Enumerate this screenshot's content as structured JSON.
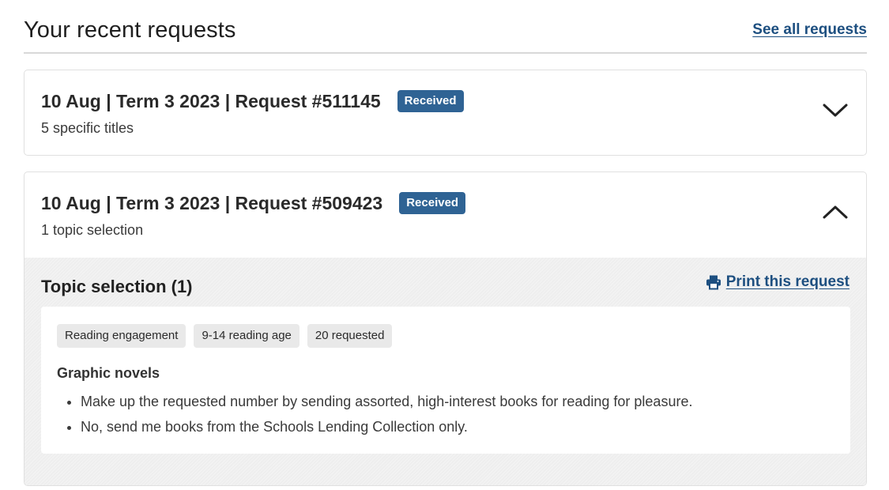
{
  "header": {
    "title": "Your recent requests",
    "see_all_label": "See all requests"
  },
  "requests": [
    {
      "title": "10 Aug | Term 3 2023 | Request #511145",
      "status": "Received",
      "summary": "5 specific titles",
      "expanded": false
    },
    {
      "title": "10 Aug | Term 3 2023 | Request #509423",
      "status": "Received",
      "summary": "1 topic selection",
      "expanded": true,
      "details": {
        "section_title": "Topic selection (1)",
        "print_label": "Print this request",
        "tags": [
          "Reading engagement",
          "9-14 reading age",
          "20 requested"
        ],
        "item_title": "Graphic novels",
        "bullets": [
          "Make up the requested number by sending assorted, high-interest books for reading for pleasure.",
          "No, send me books from the Schools Lending Collection only."
        ]
      }
    }
  ],
  "icons": {
    "collapsed": "chevron-down-icon",
    "expanded": "chevron-up-icon",
    "print": "printer-icon"
  },
  "colors": {
    "badge": "#2f6394",
    "link": "#1d4f80",
    "panel_bg": "#eeeeee"
  }
}
